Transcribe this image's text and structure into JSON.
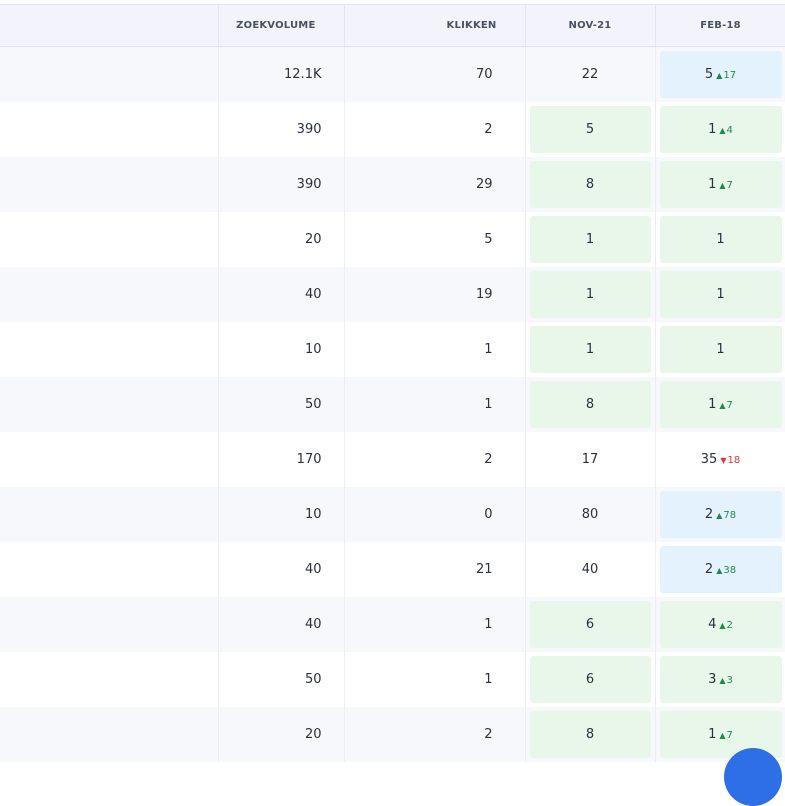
{
  "columns": {
    "volume": "ZOEKVOLUME",
    "clicks": "KLIKKEN",
    "nov": "NOV-21",
    "feb": "FEB-18"
  },
  "rows": [
    {
      "volume": "12.1K",
      "clicks": "70",
      "nov": "22",
      "nov_hl": "none",
      "feb": "5",
      "feb_hl": "blue",
      "chg": "17",
      "dir": "up"
    },
    {
      "volume": "390",
      "clicks": "2",
      "nov": "5",
      "nov_hl": "green",
      "feb": "1",
      "feb_hl": "green",
      "chg": "4",
      "dir": "up"
    },
    {
      "volume": "390",
      "clicks": "29",
      "nov": "8",
      "nov_hl": "green",
      "feb": "1",
      "feb_hl": "green",
      "chg": "7",
      "dir": "up"
    },
    {
      "volume": "20",
      "clicks": "5",
      "nov": "1",
      "nov_hl": "green",
      "feb": "1",
      "feb_hl": "green",
      "chg": "",
      "dir": ""
    },
    {
      "volume": "40",
      "clicks": "19",
      "nov": "1",
      "nov_hl": "green",
      "feb": "1",
      "feb_hl": "green",
      "chg": "",
      "dir": ""
    },
    {
      "volume": "10",
      "clicks": "1",
      "nov": "1",
      "nov_hl": "green",
      "feb": "1",
      "feb_hl": "green",
      "chg": "",
      "dir": ""
    },
    {
      "volume": "50",
      "clicks": "1",
      "nov": "8",
      "nov_hl": "green",
      "feb": "1",
      "feb_hl": "green",
      "chg": "7",
      "dir": "up"
    },
    {
      "volume": "170",
      "clicks": "2",
      "nov": "17",
      "nov_hl": "none",
      "feb": "35",
      "feb_hl": "none",
      "chg": "18",
      "dir": "down"
    },
    {
      "volume": "10",
      "clicks": "0",
      "nov": "80",
      "nov_hl": "none",
      "feb": "2",
      "feb_hl": "blue",
      "chg": "78",
      "dir": "up"
    },
    {
      "volume": "40",
      "clicks": "21",
      "nov": "40",
      "nov_hl": "none",
      "feb": "2",
      "feb_hl": "blue",
      "chg": "38",
      "dir": "up"
    },
    {
      "volume": "40",
      "clicks": "1",
      "nov": "6",
      "nov_hl": "green",
      "feb": "4",
      "feb_hl": "green",
      "chg": "2",
      "dir": "up"
    },
    {
      "volume": "50",
      "clicks": "1",
      "nov": "6",
      "nov_hl": "green",
      "feb": "3",
      "feb_hl": "green",
      "chg": "3",
      "dir": "up"
    },
    {
      "volume": "20",
      "clicks": "2",
      "nov": "8",
      "nov_hl": "green",
      "feb": "1",
      "feb_hl": "green",
      "chg": "7",
      "dir": "up"
    }
  ],
  "colors": {
    "green_highlight": "#e8f7ea",
    "blue_highlight": "#e3f2fd",
    "up": "#1e8a4f",
    "down": "#e0353b",
    "fab": "#2e6ee6"
  },
  "icons": {
    "up": "caret-up-icon",
    "down": "caret-down-icon"
  }
}
